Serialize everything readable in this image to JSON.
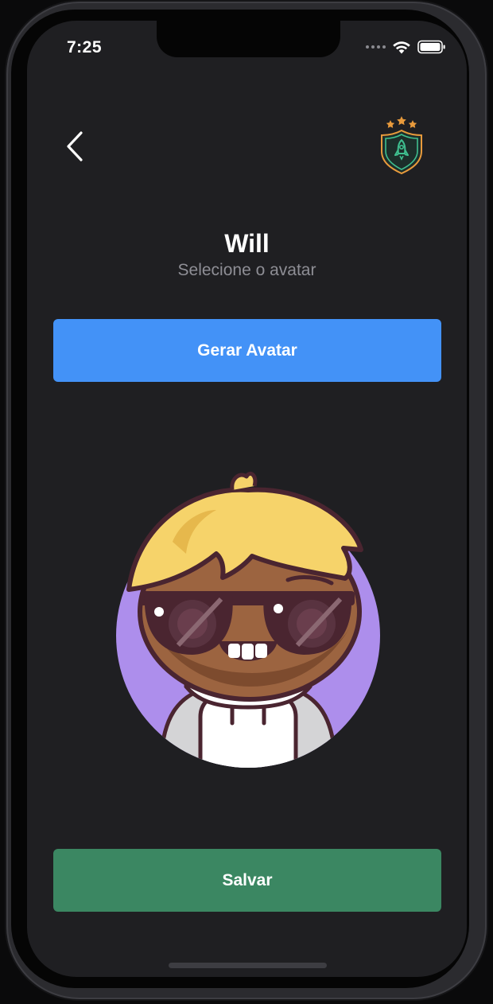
{
  "status_bar": {
    "time": "7:25"
  },
  "header": {
    "back_icon": "chevron-left-icon",
    "badge_icon": "rocket-shield-badge-icon"
  },
  "profile": {
    "name": "Will",
    "subtitle": "Selecione o avatar"
  },
  "actions": {
    "generate_label": "Gerar Avatar",
    "save_label": "Salvar"
  },
  "colors": {
    "background": "#1f1f22",
    "primary_button": "#4392f7",
    "save_button": "#3b8762",
    "avatar_circle": "#ad8eec"
  }
}
